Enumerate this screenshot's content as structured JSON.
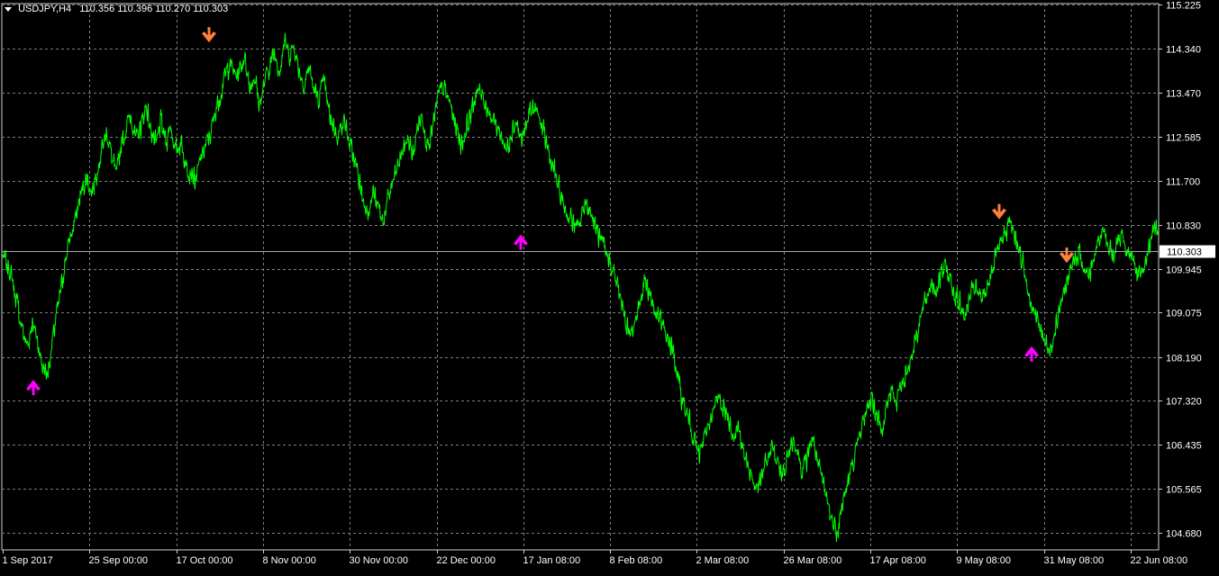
{
  "header": {
    "symbol_tf": "USDJPY,H4",
    "ohlc": "110.356 110.396 110.270 110.303"
  },
  "colors": {
    "background": "#000000",
    "line": "#00ff00",
    "grid": "#7f7f7f",
    "axis_text": "#ffffff",
    "bid_line": "#a0a8b0",
    "buy_arrow": "#ff00ff",
    "sell_arrow": "#ff7f3f"
  },
  "price_label": "110.303",
  "chart_data": {
    "type": "line",
    "title": "",
    "y_ticks": [
      "115.225",
      "114.340",
      "113.470",
      "112.585",
      "111.700",
      "110.830",
      "109.945",
      "109.075",
      "108.190",
      "107.320",
      "106.435",
      "105.565",
      "104.680"
    ],
    "x_ticks": [
      "1 Sep 2017",
      "25 Sep 00:00",
      "17 Oct 00:00",
      "8 Nov 00:00",
      "30 Nov 00:00",
      "22 Dec 00:00",
      "17 Jan 08:00",
      "8 Feb 08:00",
      "2 Mar 08:00",
      "26 Mar 08:00",
      "17 Apr 08:00",
      "9 May 08:00",
      "31 May 08:00",
      "22 Jun 08:00"
    ],
    "ylim": [
      104.5,
      115.3
    ],
    "current_price": 110.303,
    "x": [
      0,
      1,
      2,
      3,
      4,
      5,
      6,
      7,
      8,
      9,
      10,
      11,
      12,
      13,
      14,
      15,
      16,
      17,
      18,
      19,
      20,
      21,
      22,
      23,
      24,
      25,
      26,
      27,
      28,
      29,
      30,
      31,
      32,
      33,
      34,
      35,
      36,
      37,
      38,
      39,
      40,
      41,
      42,
      43,
      44,
      45,
      46,
      47,
      48,
      49,
      50,
      51,
      52,
      53,
      54,
      55,
      56,
      57,
      58,
      59,
      60,
      61,
      62,
      63,
      64,
      65,
      66,
      67,
      68,
      69,
      70,
      71,
      72,
      73,
      74,
      75,
      76,
      77,
      78,
      79,
      80,
      81,
      82,
      83,
      84,
      85,
      86,
      87,
      88,
      89,
      90,
      91,
      92,
      93,
      94,
      95,
      96,
      97,
      98,
      99,
      100,
      101,
      102,
      103,
      104,
      105,
      106,
      107,
      108,
      109,
      110,
      111,
      112,
      113,
      114,
      115,
      116,
      117,
      118,
      119,
      120,
      121,
      122,
      123,
      124,
      125,
      126,
      127,
      128,
      129,
      130,
      131,
      132,
      133,
      134,
      135,
      136,
      137,
      138,
      139,
      140,
      141,
      142,
      143,
      144,
      145,
      146,
      147,
      148,
      149,
      150,
      151,
      152,
      153,
      154,
      155,
      156,
      157,
      158,
      159,
      160,
      161,
      162,
      163,
      164,
      165,
      166,
      167,
      168,
      169,
      170,
      171,
      172,
      173,
      174,
      175,
      176,
      177,
      178,
      179,
      180,
      181,
      182,
      183,
      184,
      185,
      186,
      187,
      188,
      189,
      190,
      191,
      192,
      193,
      194,
      195,
      196,
      197,
      198,
      199,
      200,
      201,
      202,
      203,
      204,
      205,
      206,
      207,
      208,
      209,
      210,
      211,
      212,
      213,
      214,
      215,
      216,
      217,
      218,
      219,
      220,
      221,
      222,
      223,
      224,
      225,
      226,
      227,
      228,
      229,
      230,
      231,
      232,
      233,
      234,
      235,
      236,
      237,
      238,
      239,
      240,
      241,
      242,
      243,
      244,
      245,
      246,
      247,
      248,
      249,
      250,
      251,
      252,
      253,
      254,
      255,
      256,
      257,
      258,
      259,
      260,
      261,
      262,
      263,
      264,
      265,
      266,
      267,
      268,
      269,
      270,
      271,
      272,
      273,
      274,
      275,
      276,
      277,
      278,
      279,
      280,
      281,
      282,
      283,
      284,
      285,
      286,
      287,
      288,
      289,
      290,
      291,
      292,
      293,
      294,
      295,
      296,
      297,
      298,
      299,
      300,
      301,
      302,
      303,
      304,
      305,
      306,
      307,
      308,
      309,
      310,
      311,
      312,
      313,
      314,
      315,
      316,
      317,
      318,
      319
    ],
    "series": [
      {
        "values": [
          110.2,
          110.0,
          109.7,
          109.2,
          108.7,
          108.4,
          108.9,
          108.5,
          108.0,
          107.8,
          108.5,
          109.1,
          109.7,
          110.3,
          110.7,
          111.1,
          111.5,
          111.8,
          111.4,
          111.9,
          112.3,
          112.7,
          112.2,
          111.8,
          112.4,
          112.8,
          113.0,
          112.5,
          112.8,
          113.2,
          112.7,
          112.4,
          112.9,
          112.5,
          112.8,
          112.3,
          112.5,
          112.0,
          111.9,
          111.7,
          112.1,
          112.4,
          112.6,
          113.1,
          113.4,
          113.8,
          114.1,
          113.8,
          113.9,
          114.2,
          113.6,
          113.8,
          113.2,
          113.7,
          114.0,
          114.3,
          113.9,
          114.5,
          114.2,
          114.4,
          113.9,
          113.6,
          114.0,
          113.5,
          113.3,
          113.7,
          113.1,
          112.8,
          112.6,
          113.0,
          112.5,
          112.2,
          111.8,
          111.3,
          111.1,
          111.5,
          111.2,
          110.9,
          111.3,
          111.7,
          112.0,
          112.3,
          112.6,
          112.2,
          112.8,
          113.0,
          112.4,
          112.7,
          113.3,
          113.6,
          113.4,
          113.1,
          112.7,
          112.4,
          112.8,
          113.1,
          113.5,
          113.4,
          113.2,
          113.0,
          112.8,
          112.6,
          112.3,
          112.7,
          112.9,
          112.5,
          112.8,
          113.2,
          113.1,
          112.8,
          112.5,
          112.1,
          111.8,
          111.4,
          111.1,
          111.0,
          110.7,
          110.9,
          111.3,
          111.1,
          110.8,
          110.5,
          110.3,
          110.1,
          109.8,
          109.4,
          109.0,
          108.6,
          108.9,
          109.3,
          109.7,
          109.5,
          109.1,
          109.0,
          108.7,
          108.5,
          108.2,
          107.6,
          107.2,
          106.9,
          106.6,
          106.2,
          106.5,
          106.9,
          107.1,
          107.4,
          107.2,
          106.9,
          106.7,
          106.8,
          106.3,
          106.0,
          105.7,
          105.5,
          105.9,
          106.2,
          106.4,
          106.0,
          105.8,
          106.2,
          106.6,
          106.3,
          105.9,
          106.2,
          106.6,
          106.1,
          105.7,
          105.3,
          104.9,
          104.7,
          105.2,
          105.6,
          106.0,
          106.4,
          106.8,
          107.1,
          107.4,
          107.0,
          106.8,
          107.2,
          107.5,
          107.3,
          107.6,
          107.9,
          108.2,
          108.6,
          109.0,
          109.3,
          109.7,
          109.5,
          109.8,
          110.0,
          109.7,
          109.4,
          109.2,
          109.0,
          109.4,
          109.6,
          109.3,
          109.5,
          109.8,
          110.1,
          110.4,
          110.7,
          110.9,
          110.6,
          110.3,
          109.9,
          109.4,
          109.1,
          108.8,
          108.5,
          108.3,
          108.7,
          109.1,
          109.5,
          109.8,
          110.1,
          110.3,
          110.0,
          109.8,
          110.2,
          110.5,
          110.7,
          110.4,
          110.2,
          110.5,
          110.6,
          110.3,
          110.0,
          109.8,
          110.0,
          110.3,
          110.6,
          110.8
        ],
        "color": "#00ff00"
      }
    ],
    "markers": [
      {
        "type": "buy",
        "x": 10,
        "y": 107.75
      },
      {
        "type": "sell",
        "x": 61,
        "y": 114.45
      },
      {
        "type": "buy",
        "x": 164,
        "y": 110.65
      },
      {
        "type": "sell",
        "x": 326,
        "y": 110.92
      },
      {
        "type": "sell",
        "x": 348,
        "y": 110.05
      },
      {
        "type": "buy",
        "x": 337,
        "y": 108.42
      }
    ]
  }
}
